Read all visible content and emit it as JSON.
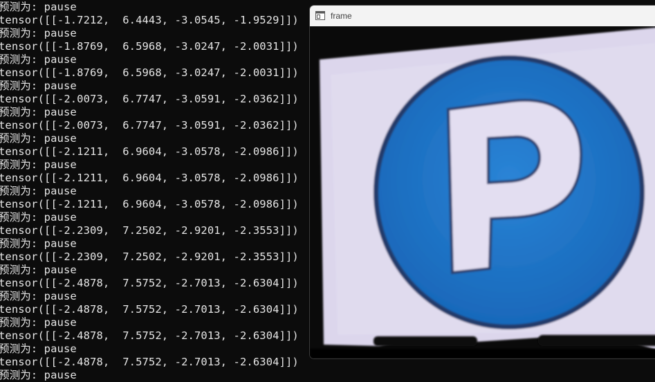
{
  "terminal": {
    "lines": [
      "预测为: pause",
      "tensor([[-1.7212,  6.4443, -3.0545, -1.9529]])",
      "预测为: pause",
      "tensor([[-1.8769,  6.5968, -3.0247, -2.0031]])",
      "预测为: pause",
      "tensor([[-1.8769,  6.5968, -3.0247, -2.0031]])",
      "预测为: pause",
      "tensor([[-2.0073,  6.7747, -3.0591, -2.0362]])",
      "预测为: pause",
      "tensor([[-2.0073,  6.7747, -3.0591, -2.0362]])",
      "预测为: pause",
      "tensor([[-2.1211,  6.9604, -3.0578, -2.0986]])",
      "预测为: pause",
      "tensor([[-2.1211,  6.9604, -3.0578, -2.0986]])",
      "预测为: pause",
      "tensor([[-2.1211,  6.9604, -3.0578, -2.0986]])",
      "预测为: pause",
      "tensor([[-2.2309,  7.2502, -2.9201, -2.3553]])",
      "预测为: pause",
      "tensor([[-2.2309,  7.2502, -2.9201, -2.3553]])",
      "预测为: pause",
      "tensor([[-2.4878,  7.5752, -2.7013, -2.6304]])",
      "预测为: pause",
      "tensor([[-2.4878,  7.5752, -2.7013, -2.6304]])",
      "预测为: pause",
      "tensor([[-2.4878,  7.5752, -2.7013, -2.6304]])",
      "预测为: pause",
      "tensor([[-2.4878,  7.5752, -2.7013, -2.6304]])",
      "预测为: pause"
    ],
    "text_color": "#e6e6e6",
    "background": "#0c0c0c"
  },
  "frame_window": {
    "title": "frame",
    "titlebar_color": "#f3f3f3",
    "image": {
      "subject": "parking-sign",
      "sign_letter": "P",
      "circle_color": "#1e74c8",
      "background_color": "#dcd8ec"
    }
  }
}
